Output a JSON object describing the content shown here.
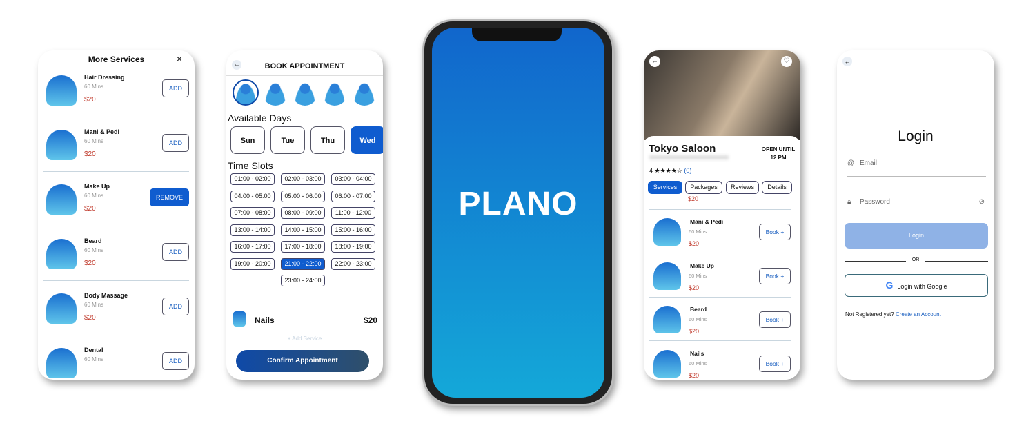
{
  "more_services": {
    "title": "More Services",
    "close": "×",
    "items": [
      {
        "name": "Hair Dressing",
        "duration": "60 Mins",
        "price": "$20",
        "action": "ADD"
      },
      {
        "name": "Mani & Pedi",
        "duration": "60 Mins",
        "price": "$20",
        "action": "ADD"
      },
      {
        "name": "Make Up",
        "duration": "60 Mins",
        "price": "$20",
        "action": "REMOVE"
      },
      {
        "name": "Beard",
        "duration": "60 Mins",
        "price": "$20",
        "action": "ADD"
      },
      {
        "name": "Body Massage",
        "duration": "60 Mins",
        "price": "$20",
        "action": "ADD"
      },
      {
        "name": "Dental",
        "duration": "60 Mins",
        "price": "",
        "action": "ADD"
      }
    ]
  },
  "booking": {
    "back": "←",
    "title": "BOOK APPOINTMENT",
    "days_label": "Available Days",
    "days": [
      "Sun",
      "Tue",
      "Thu",
      "Wed"
    ],
    "selected_day": "Wed",
    "slots_label": "Time Slots",
    "slots": [
      "01:00 - 02:00",
      "02:00 - 03:00",
      "03:00 - 04:00",
      "04:00 - 05:00",
      "05:00 - 06:00",
      "06:00 - 07:00",
      "07:00 - 08:00",
      "08:00 - 09:00",
      "11:00 - 12:00",
      "13:00 - 14:00",
      "14:00 - 15:00",
      "15:00 - 16:00",
      "16:00 - 17:00",
      "17:00 - 18:00",
      "18:00 - 19:00",
      "19:00 - 20:00",
      "21:00 - 22:00",
      "22:00 - 23:00",
      "23:00 - 24:00"
    ],
    "selected_slot": "21:00 - 22:00",
    "service_name": "Nails",
    "service_price": "$20",
    "add_service": "+ Add Service",
    "confirm": "Confirm Appointment"
  },
  "splash": {
    "logo": "PLANO",
    "gradient": [
      "#1166cc",
      "#14a8d8"
    ]
  },
  "salon": {
    "name": "Tokyo Saloon",
    "open_label": "OPEN UNTIL",
    "open_time": "12 PM",
    "rating": "4",
    "stars": "★★★★☆",
    "reviews": "(0)",
    "tabs": [
      "Services",
      "Packages",
      "Reviews",
      "Details"
    ],
    "first_price": "$20",
    "items": [
      {
        "name": "Mani & Pedi",
        "duration": "60 Mins",
        "price": "$20",
        "action": "Book +"
      },
      {
        "name": "Make Up",
        "duration": "60 Mins",
        "price": "$20",
        "action": "Book +"
      },
      {
        "name": "Beard",
        "duration": "60 Mins",
        "price": "$20",
        "action": "Book +"
      },
      {
        "name": "Nails",
        "duration": "60 Mins",
        "price": "$20",
        "action": "Book +"
      }
    ]
  },
  "login": {
    "back": "←",
    "title": "Login",
    "email_placeholder": "Email",
    "password_placeholder": "Password",
    "login_button": "Login",
    "or": "OR",
    "google_button": "Login with Google",
    "not_registered": "Not Registered yet?",
    "create_account": "Create an Account"
  },
  "colors": {
    "accent": "#0f5ccf",
    "price": "#c0392b"
  }
}
